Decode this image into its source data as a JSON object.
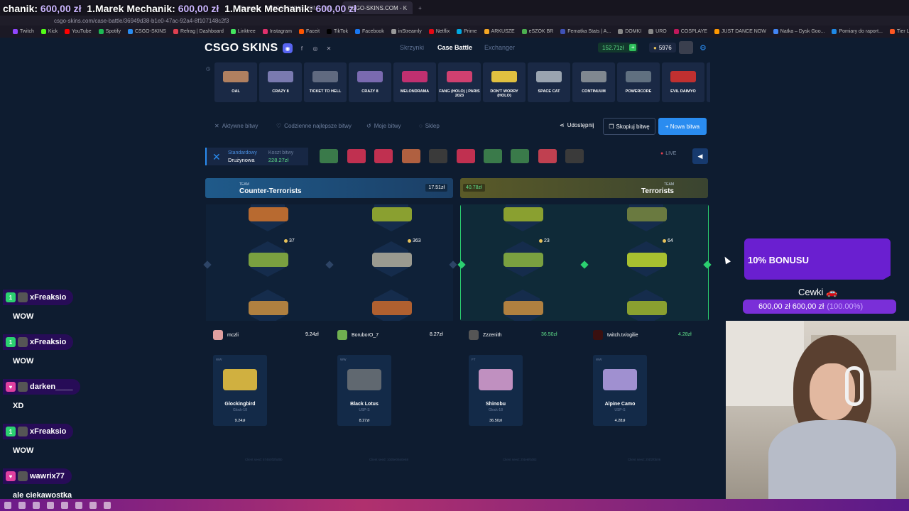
{
  "overlay": {
    "title_prefix": "chanik:",
    "title_amount": "600,00 zł",
    "title_mid": "1.Marek Mechanik:",
    "title_amount2": "600,00 zł",
    "title_mid2": "1.Marek Mechanik:",
    "title_amount3": "600,00 zł"
  },
  "browser": {
    "tabs": [
      {
        "label": "Twitch"
      },
      {
        "label": "CSGO-SKINS.COM - Naj..."
      },
      {
        "label": "CSGO-SKINS.COM - K"
      }
    ],
    "url": "csgo-skins.com/case-battle/36949d38-b1e0-47ac-92a4-8f107148c2f3",
    "bookmarks": [
      "Twitch",
      "Kick",
      "YouTube",
      "Spotify",
      "CSGO-SKINS",
      "Refrag | Dashboard",
      "Linktree",
      "Instagram",
      "Faceit",
      "TikTok",
      "Facebook",
      "inStreamly",
      "Netflix",
      "Prime",
      "ARKUSZE",
      "eSZOK BR",
      "Fematka Stats | A...",
      "DOMKI",
      "URO",
      "COSPLAYE",
      "JUST DANCE NOW",
      "Natka – Dysk Goo...",
      "Pomiary do raport...",
      "Tier List Maker for..."
    ]
  },
  "site": {
    "logo": "CSGO SKINS",
    "nav": [
      {
        "label": "Skrzynki"
      },
      {
        "label": "Case Battle"
      },
      {
        "label": "Exchanger"
      }
    ],
    "balance": "152.71zł",
    "coins": "5976"
  },
  "drop": [
    {
      "name": "OAL"
    },
    {
      "name": "CRAZY 8"
    },
    {
      "name": "TICKET TO HELL"
    },
    {
      "name": "CRAZY 8"
    },
    {
      "name": "MELONDRAMA"
    },
    {
      "name": "FANG (HOLO) | PARIS 2023"
    },
    {
      "name": "DON'T WORRY (HOLO)"
    },
    {
      "name": "SPACE CAT"
    },
    {
      "name": "CONTINUUM"
    },
    {
      "name": "POWERCORE"
    },
    {
      "name": "EVIL DAIMYO"
    },
    {
      "name": "CHO"
    }
  ],
  "battle_tabs": {
    "active_battles": "Aktywne bitwy",
    "daily": "Codzienne najlepsze bitwy",
    "mine": "Moje bitwy",
    "shop": "Sklep",
    "share": "Udostępnij",
    "copy": "Skopiuj bitwę",
    "new": "+ Nowa bitwa"
  },
  "info": {
    "mode_top": "Standardowy",
    "mode_bottom": "Drużynowa",
    "cost_label": "Koszt bitwy",
    "cost": "228.27zł",
    "live": "LIVE"
  },
  "teams": {
    "ct": {
      "small": "TEAM",
      "name": "Counter-Terrorists",
      "value": "17.51zł"
    },
    "t": {
      "small": "TEAM",
      "name": "Terrorists",
      "value": "40.78zł"
    }
  },
  "lanes": [
    {
      "coins": "37"
    },
    {
      "coins": "363"
    },
    {
      "coins": "23"
    },
    {
      "coins": "64"
    }
  ],
  "players": [
    {
      "name": "mczli",
      "value": "9.24zł"
    },
    {
      "name": "BoruborO_7",
      "value": "8.27zł"
    },
    {
      "name": "Zzzenith",
      "value": "36.50zł"
    },
    {
      "name": "twitch.tv/ogilie",
      "value": "4.28zł"
    }
  ],
  "wins": [
    {
      "q": "WW",
      "name": "Glockingbird",
      "sub": "Glock-18",
      "value": "9.24zł"
    },
    {
      "q": "WW",
      "name": "Black Lotus",
      "sub": "USP-S",
      "value": "8.27zł"
    },
    {
      "q": "FT",
      "name": "Shinobu",
      "sub": "Glock-18",
      "value": "36.50zł"
    },
    {
      "q": "WW",
      "name": "Alpine Camo",
      "sub": "USP-S",
      "value": "4.28zł"
    }
  ],
  "stream": {
    "bonus": "10% BONUSU",
    "goal_name": "Cewki 🚗",
    "goal_amount": "600,00 zł  600,00 zł",
    "goal_pct": "(100.00%)"
  },
  "chat": [
    {
      "user": "xFreaksio",
      "msg": "WOW"
    },
    {
      "user": "xFreaksio",
      "msg": "WOW"
    },
    {
      "user": "darken____",
      "msg": "XD"
    },
    {
      "user": "xFreaksio",
      "msg": "WOW"
    },
    {
      "user": "wawrix77",
      "msg": "ale ciekawostka"
    }
  ],
  "colors": {
    "accent": "#2a8cf0",
    "green": "#2bd070",
    "purple": "#6a1fd0"
  }
}
